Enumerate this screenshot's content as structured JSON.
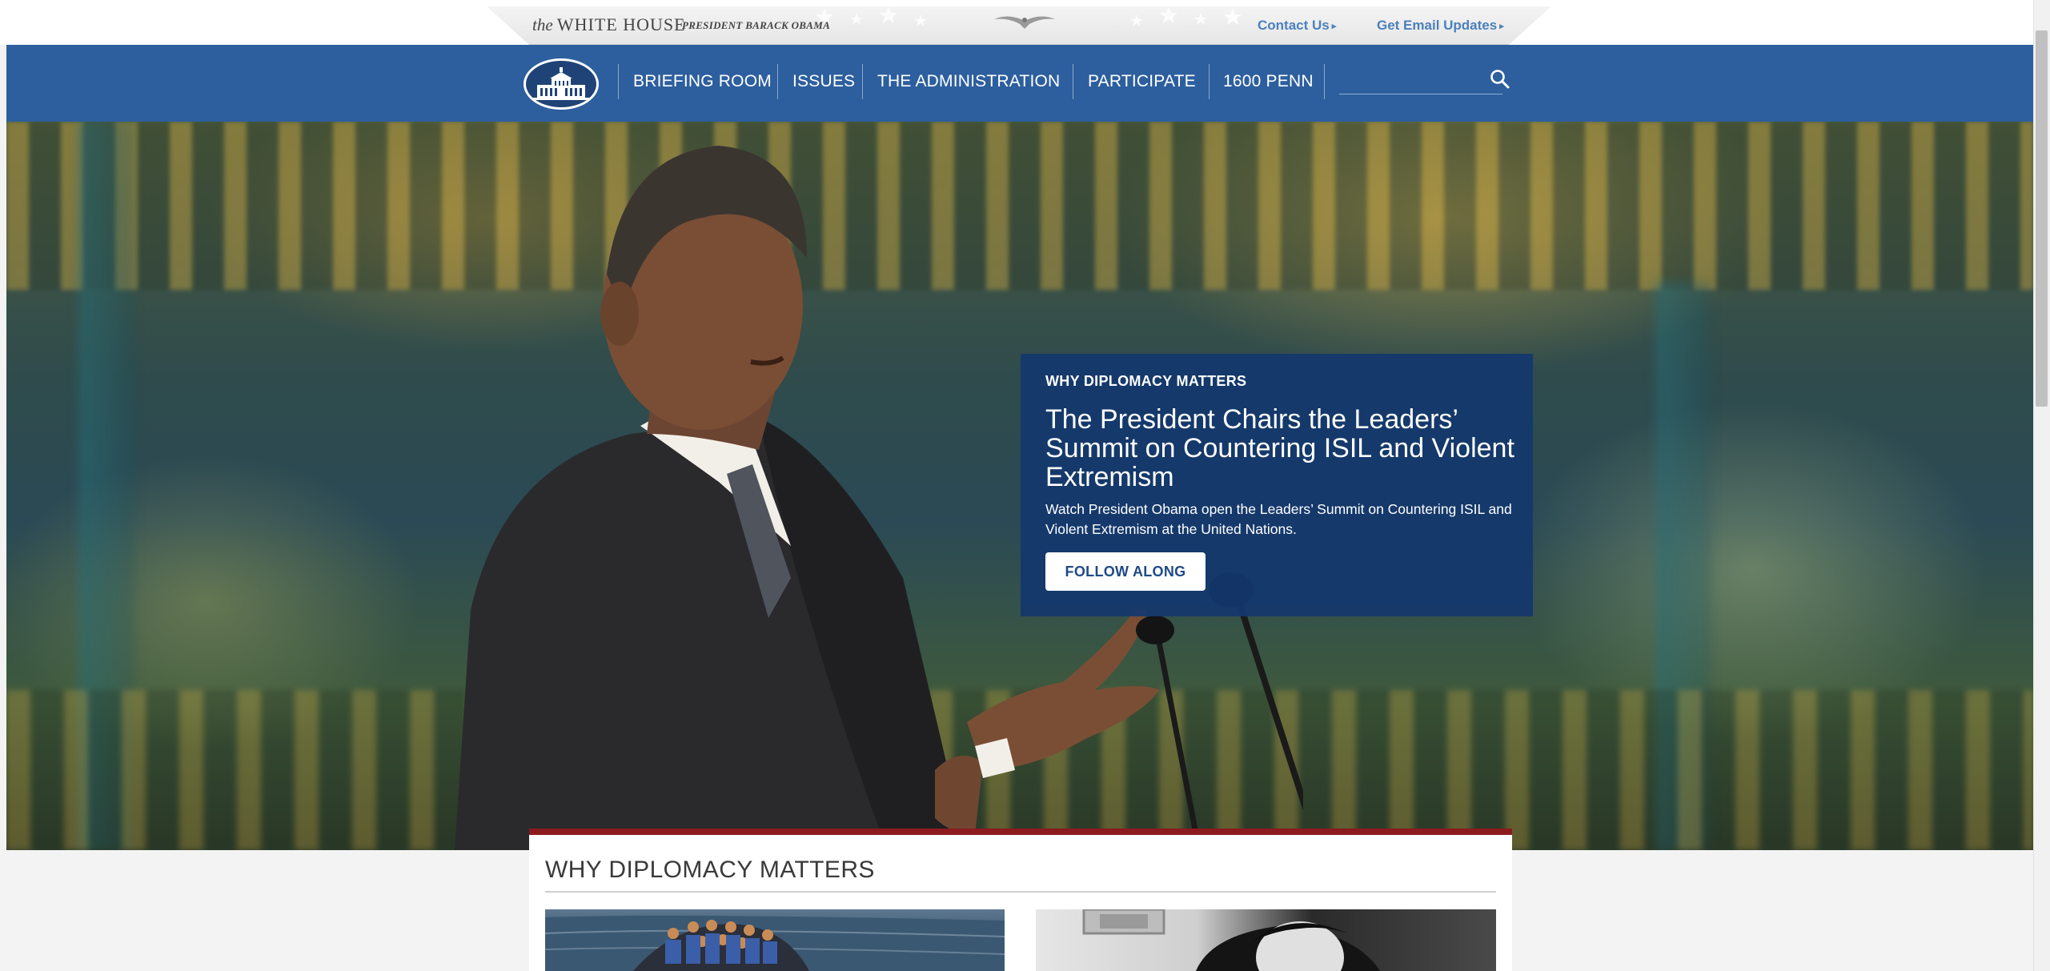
{
  "header": {
    "logo_prefix": "the",
    "logo_main": "WHITE HOUSE",
    "logo_sub": "PRESIDENT BARACK OBAMA",
    "utility_links": [
      {
        "label": "Contact Us"
      },
      {
        "label": "Get Email Updates"
      }
    ]
  },
  "nav": {
    "items": [
      {
        "label": "BRIEFING ROOM"
      },
      {
        "label": "ISSUES"
      },
      {
        "label": "THE ADMINISTRATION"
      },
      {
        "label": "PARTICIPATE"
      },
      {
        "label": "1600 PENN"
      }
    ],
    "search": {
      "placeholder": "",
      "value": "",
      "icon": "search-icon"
    }
  },
  "hero": {
    "kicker": "WHY DIPLOMACY MATTERS",
    "title": "The President Chairs the Leaders’ Summit on Countering ISIL and Violent Extremism",
    "description": "Watch President Obama open the Leaders’ Summit on Countering ISIL and Violent Extremism at the United Nations.",
    "button_label": "FOLLOW ALONG"
  },
  "section": {
    "title": "WHY DIPLOMACY MATTERS"
  },
  "colors": {
    "nav_blue": "#2d5f9e",
    "card_blue": "#14376e",
    "accent_red": "#8b1b1f",
    "link_blue": "#4c80bc"
  }
}
